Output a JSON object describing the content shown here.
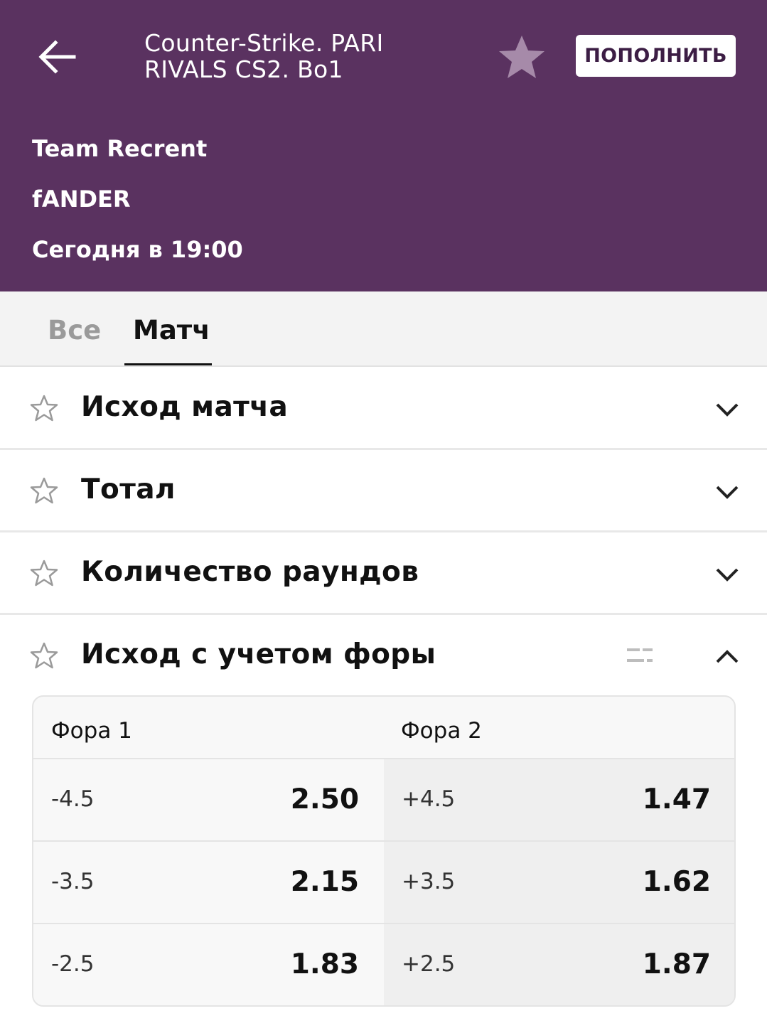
{
  "header": {
    "title": "Counter-Strike. PARI RIVALS CS2. Bo1",
    "deposit_label": "ПОПОЛНИТЬ",
    "team1": "Team Recrent",
    "team2": "fANDER",
    "match_time": "Сегодня в 19:00",
    "background_color": "#5a3260",
    "icons": [
      "arrow-left-icon",
      "star-filled-icon"
    ]
  },
  "tabs": [
    {
      "label": "Все",
      "active": false
    },
    {
      "label": "Матч",
      "active": true
    }
  ],
  "markets": [
    {
      "title": "Исход матча",
      "expanded": false
    },
    {
      "title": "Тотал",
      "expanded": false
    },
    {
      "title": "Количество раундов",
      "expanded": false
    },
    {
      "title": "Исход с учетом форы",
      "expanded": true
    }
  ],
  "handicap": {
    "column1": "Фора 1",
    "column2": "Фора 2",
    "rows": [
      {
        "h1": "-4.5",
        "c1": "2.50",
        "h2": "+4.5",
        "c2": "1.47"
      },
      {
        "h1": "-3.5",
        "c1": "2.15",
        "h2": "+3.5",
        "c2": "1.62"
      },
      {
        "h1": "-2.5",
        "c1": "1.83",
        "h2": "+2.5",
        "c2": "1.87"
      }
    ]
  }
}
